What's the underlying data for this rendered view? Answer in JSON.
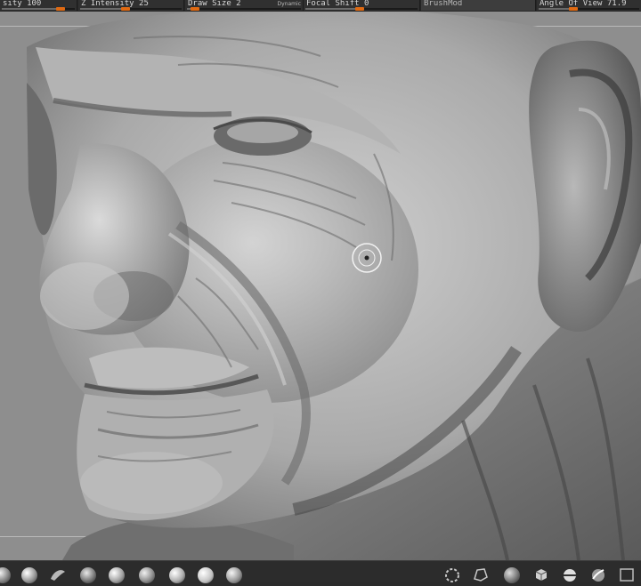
{
  "toolbar": {
    "intensity_label": "sity 100",
    "z_intensity_label": "Z Intensity 25",
    "draw_size_label": "Draw Size 2",
    "dynamic_label": "Dynamic",
    "focal_shift_label": "Focal Shift 0",
    "brush_mod_label": "BrushMod",
    "angle_of_view_label": "Angle Of View 71.9"
  },
  "slider_values": {
    "intensity": 100,
    "z_intensity": 25,
    "draw_size": 2,
    "focal_shift": 0,
    "angle_of_view": 71.9
  },
  "viewport": {
    "subject": "sculpted-old-man-head",
    "cursor": "brush-cursor"
  },
  "shelf": {
    "items": [
      "material-ball-1",
      "material-ball-2",
      "alpha-brush-icon",
      "material-ball-3",
      "material-ball-4",
      "material-ball-5",
      "material-ball-6",
      "material-ball-7",
      "material-ball-8",
      "gizmo-icon",
      "lasso-icon",
      "material-ball-9",
      "cube-icon",
      "sphere-tool-icon",
      "standard-brush-icon",
      "frame-icon"
    ]
  },
  "colors": {
    "accent": "#e06a12",
    "viewport_bg": "#8e8e8e",
    "ui_bg": "#2b2b2b"
  }
}
